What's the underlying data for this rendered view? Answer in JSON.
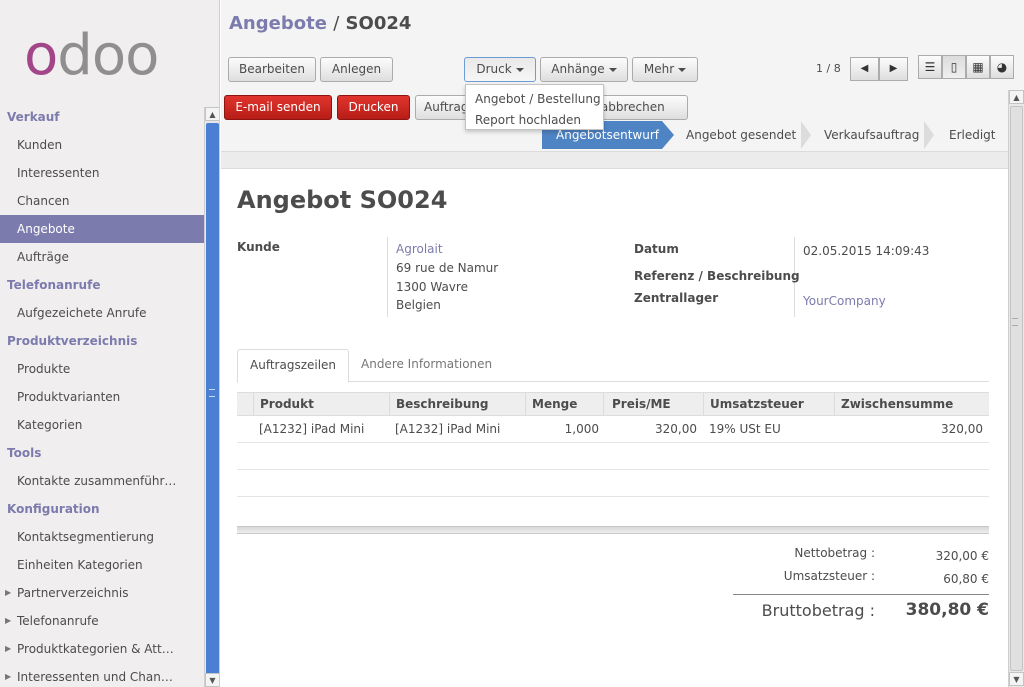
{
  "logo": {
    "first": "o",
    "rest": "doo"
  },
  "sidebar": {
    "sections": [
      {
        "label": "Verkauf",
        "items": [
          "Kunden",
          "Interessenten",
          "Chancen",
          "Angebote",
          "Aufträge"
        ]
      },
      {
        "label": "Telefonanrufe",
        "items": [
          "Aufgezeichete Anrufe"
        ]
      },
      {
        "label": "Produktverzeichnis",
        "items": [
          "Produkte",
          "Produktvarianten",
          "Kategorien"
        ]
      },
      {
        "label": "Tools",
        "items": [
          "Kontakte zusammenführ…"
        ]
      },
      {
        "label": "Konfiguration",
        "items": [
          "Kontaktsegmentierung",
          "Einheiten Kategorien",
          "Partnerverzeichnis",
          "Telefonanrufe",
          "Produktkategorien & Att…",
          "Interessenten und Chan…"
        ]
      }
    ],
    "active_item": "Angebote"
  },
  "breadcrumb": {
    "parent": "Angebote",
    "separator": "/",
    "current": "SO024"
  },
  "toolbar": {
    "edit": "Bearbeiten",
    "create": "Anlegen",
    "print": "Druck",
    "attachments": "Anhänge",
    "more": "Mehr"
  },
  "pager": {
    "text": "1 / 8"
  },
  "dropdown": {
    "items": [
      "Angebot / Bestellung",
      "Report hochladen"
    ]
  },
  "actions": {
    "send_email": "E-mail senden",
    "print": "Drucken",
    "confirm_partial": "Auftrag",
    "cancel_partial": "ot abbrechen"
  },
  "stages": [
    "Angebotsentwurf",
    "Angebot gesendet",
    "Verkaufsauftrag",
    "Erledigt"
  ],
  "form": {
    "title": "Angebot SO024",
    "customer_label": "Kunde",
    "customer_name": "Agrolait",
    "address_line1": "69 rue de Namur",
    "address_line2": "1300 Wavre",
    "address_line3": "Belgien",
    "date_label": "Datum",
    "date_value": "02.05.2015 14:09:43",
    "reference_label": "Referenz / Beschreibung",
    "warehouse_label": "Zentrallager",
    "warehouse_value": "YourCompany"
  },
  "tabs": [
    "Auftragszeilen",
    "Andere Informationen"
  ],
  "table": {
    "headers": [
      "Produkt",
      "Beschreibung",
      "Menge",
      "Preis/ME",
      "Umsatzsteuer",
      "Zwischensumme"
    ],
    "rows": [
      [
        "[A1232] iPad Mini",
        "[A1232] iPad Mini",
        "1,000",
        "320,00",
        "19% USt EU",
        "320,00"
      ]
    ]
  },
  "totals": {
    "net_label": "Nettobetrag :",
    "net_value": "320,00 €",
    "tax_label": "Umsatzsteuer :",
    "tax_value": "60,80 €",
    "gross_label": "Bruttobetrag :",
    "gross_value": "380,80 €"
  },
  "colors": {
    "accent": "#7c7bad",
    "logo_primary": "#a24689",
    "stage_active": "#4f84c4",
    "button_red": "#c9231d"
  }
}
